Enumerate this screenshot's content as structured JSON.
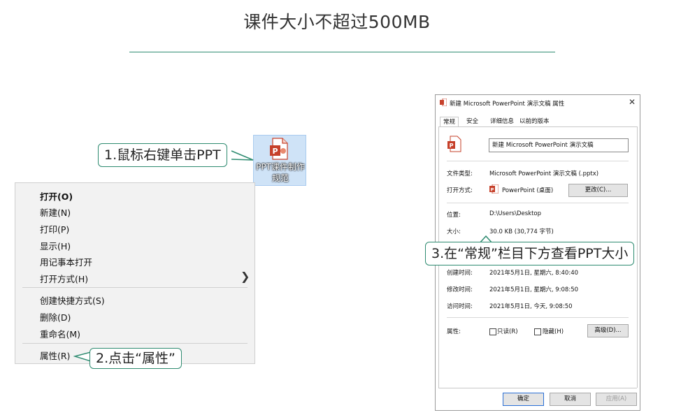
{
  "title": "课件大小不超过500MB",
  "colors": {
    "accent": "#2e8b70",
    "ppt_red": "#c6402a",
    "selection": "#cfe3f7"
  },
  "desktop_file": {
    "name": "PPT课件制作规范",
    "icon": "powerpoint-file-icon"
  },
  "callouts": {
    "step1": "1.鼠标右键单击PPT",
    "step2": "2.点击“属性”",
    "step3": "3.在“常规”栏目下方查看PPT大小"
  },
  "context_menu": {
    "items": [
      "打开(O)",
      "新建(N)",
      "打印(P)",
      "显示(H)",
      "用记事本打开",
      "打开方式(H)",
      "创建快捷方式(S)",
      "删除(D)",
      "重命名(M)",
      "属性(R)"
    ],
    "submenu_arrow_icon": "chevron-right-icon"
  },
  "properties_dialog": {
    "title": "新建 Microsoft PowerPoint 演示文稿 属性",
    "tabs": [
      "常规",
      "安全",
      "详细信息",
      "以前的版本"
    ],
    "active_tab": "常规",
    "file_name": "新建 Microsoft PowerPoint 演示文稿",
    "rows": {
      "file_type_label": "文件类型:",
      "file_type": "Microsoft PowerPoint 演示文稿 (.pptx)",
      "open_with_label": "打开方式:",
      "open_with": "PowerPoint (桌面)",
      "change_button": "更改(C)...",
      "location_label": "位置:",
      "location": "D:\\Users\\Desktop",
      "size_label": "大小:",
      "size": "30.0 KB (30,774 字节)",
      "created_label": "创建时间:",
      "created": "2021年5月1日, 星期六, 8:40:40",
      "modified_label": "修改时间:",
      "modified": "2021年5月1日, 星期六, 9:08:50",
      "accessed_label": "访问时间:",
      "accessed": "2021年5月1日, 今天, 9:08:50",
      "attributes_label": "属性:",
      "readonly": "只读(R)",
      "hidden": "隐藏(H)",
      "advanced_button": "高级(D)..."
    },
    "buttons": {
      "ok": "确定",
      "cancel": "取消",
      "apply": "应用(A)"
    }
  }
}
